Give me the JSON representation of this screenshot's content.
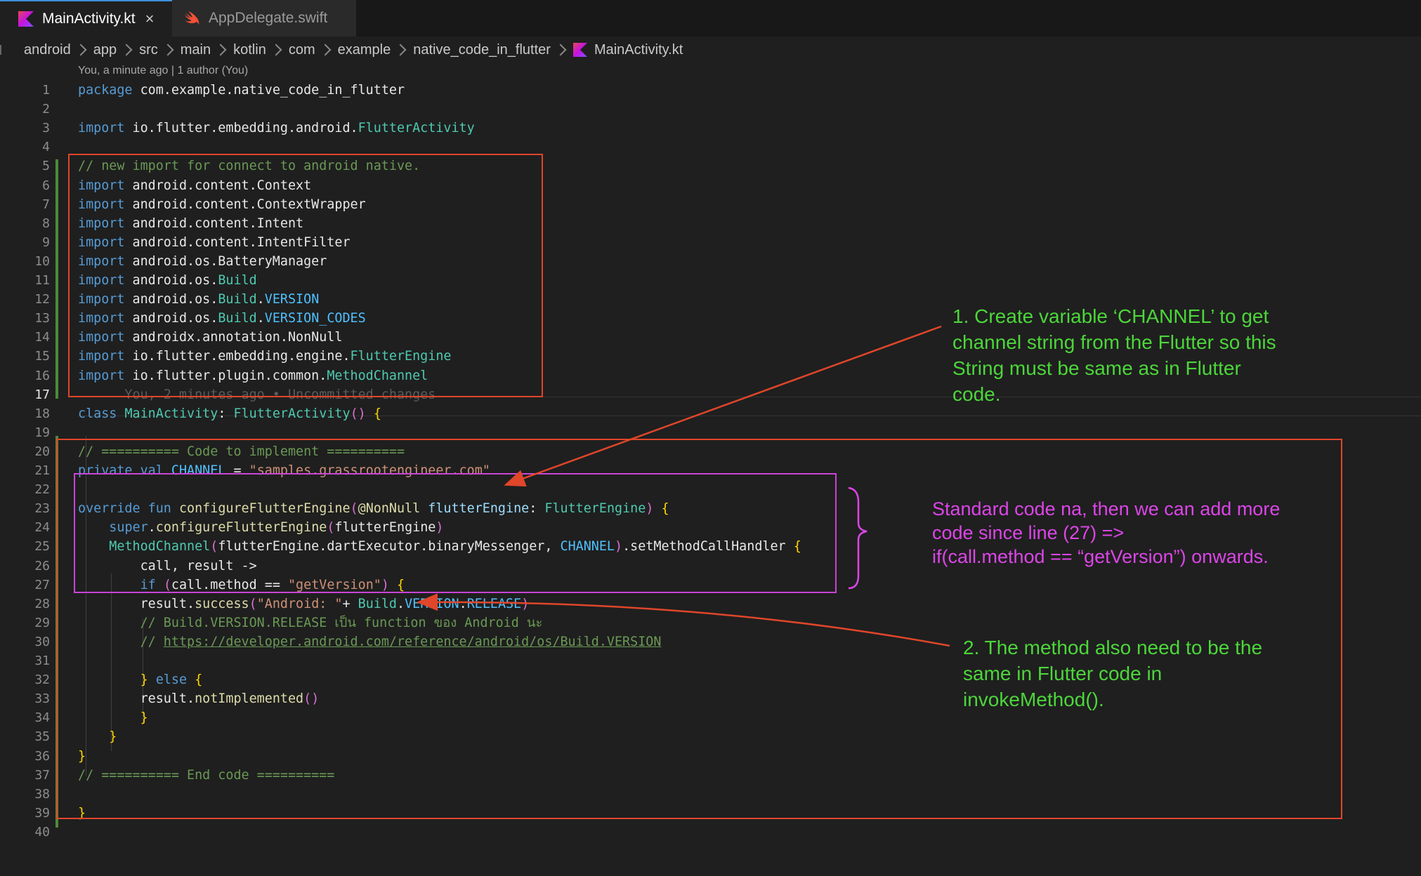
{
  "tabs": [
    {
      "label": "MainActivity.kt",
      "icon": "kotlin-icon",
      "active": true,
      "close": "×"
    },
    {
      "label": "AppDelegate.swift",
      "icon": "swift-icon",
      "active": false
    }
  ],
  "breadcrumb": [
    "android",
    "app",
    "src",
    "main",
    "kotlin",
    "com",
    "example",
    "native_code_in_flutter",
    "MainActivity.kt"
  ],
  "blame_header": "You, a minute ago | 1 author (You)",
  "current_line": 17,
  "ghost_text": "You, 2 minutes ago • Uncommitted changes",
  "code_lines": [
    "package com.example.native_code_in_flutter",
    "",
    "import io.flutter.embedding.android.FlutterActivity",
    "",
    "// new import for connect to android native.",
    "import android.content.Context",
    "import android.content.ContextWrapper",
    "import android.content.Intent",
    "import android.content.IntentFilter",
    "import android.os.BatteryManager",
    "import android.os.Build",
    "import android.os.Build.VERSION",
    "import android.os.Build.VERSION_CODES",
    "import androidx.annotation.NonNull",
    "import io.flutter.embedding.engine.FlutterEngine",
    "import io.flutter.plugin.common.MethodChannel",
    "",
    "class MainActivity: FlutterActivity() {",
    "",
    "// ========== Code to implement ==========",
    "private val CHANNEL = \"samples.grassrootengineer.com\"",
    "",
    "override fun configureFlutterEngine(@NonNull flutterEngine: FlutterEngine) {",
    "    super.configureFlutterEngine(flutterEngine)",
    "    MethodChannel(flutterEngine.dartExecutor.binaryMessenger, CHANNEL).setMethodCallHandler {",
    "        call, result ->",
    "        if (call.method == \"getVersion\") {",
    "        result.success(\"Android: \"+ Build.VERSION.RELEASE)",
    "        // Build.VERSION.RELEASE เป็น function ของ Android นะ",
    "        // https://developer.android.com/reference/android/os/Build.VERSION",
    "",
    "        } else {",
    "        result.notImplemented()",
    "        }",
    "    }",
    "}",
    "// ========== End code ==========",
    "",
    "}",
    ""
  ],
  "annotations": {
    "note1": [
      "1. Create variable ‘CHANNEL’ to get",
      "channel string from the Flutter so this",
      "String must be same as in Flutter",
      "code."
    ],
    "note_standard": [
      "Standard code na, then we can add more",
      "code since line (27) =>",
      "if(call.method == “getVersion”) onwards."
    ],
    "note2": [
      "2. The method also need to be the",
      "same in Flutter code in",
      "invokeMethod()."
    ]
  },
  "colors": {
    "editor_bg": "#1f1f1f",
    "annotation_box": "#e0462a",
    "annotation_arrow": "#e0462a",
    "highlight_box": "#c944d6",
    "note_green": "#4cd63a",
    "note_pink": "#dc45e8",
    "keyword": "#569cd6",
    "string": "#ce9178",
    "comment": "#6a9955"
  }
}
